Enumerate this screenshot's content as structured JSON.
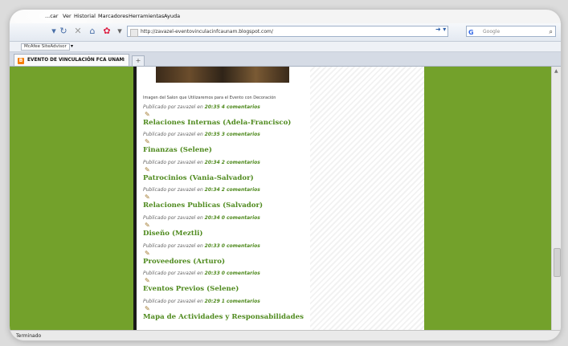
{
  "browser": {
    "menu": [
      "...car",
      "Ver",
      "Historial",
      "Marcadores",
      "Herramientas",
      "Ayuda"
    ],
    "url": "http://zavazel-eventovinculacinfcaunam.blogspot.com/",
    "search_placeholder": "Google",
    "search_engine_glyph": "G",
    "mcafee_label": "McAfee SiteAdvisor",
    "tab_title": "EVENTO DE VINCULACIÓN FCA UNAM",
    "tab_icon_letter": "B",
    "status": "Terminado"
  },
  "page": {
    "caption": "Imagen del Salon que Utilizaremos para el Evento con Decoración",
    "meta_prefix": "Publicado por zavazel en",
    "posts": [
      {
        "time": "20:35",
        "comments": "4 comentarios",
        "title": "Relaciones Internas (Adela-Francisco)"
      },
      {
        "time": "20:35",
        "comments": "3 comentarios",
        "title": "Finanzas (Selene)"
      },
      {
        "time": "20:34",
        "comments": "2 comentarios",
        "title": "Patrocinios (Vania-Salvador)"
      },
      {
        "time": "20:34",
        "comments": "2 comentarios",
        "title": "Relaciones Publicas (Salvador)"
      },
      {
        "time": "20:34",
        "comments": "0 comentarios",
        "title": "Diseño (Meztli)"
      },
      {
        "time": "20:33",
        "comments": "0 comentarios",
        "title": "Proveedores (Arturo)"
      },
      {
        "time": "20:33",
        "comments": "0 comentarios",
        "title": "Eventos Previos (Selene)"
      },
      {
        "time": "20:29",
        "comments": "1 comentarios",
        "title": "Mapa de Actividades y Responsabilidades"
      }
    ]
  },
  "colors": {
    "page_background": "#73a12b",
    "link_green": "#4f8a1e"
  }
}
